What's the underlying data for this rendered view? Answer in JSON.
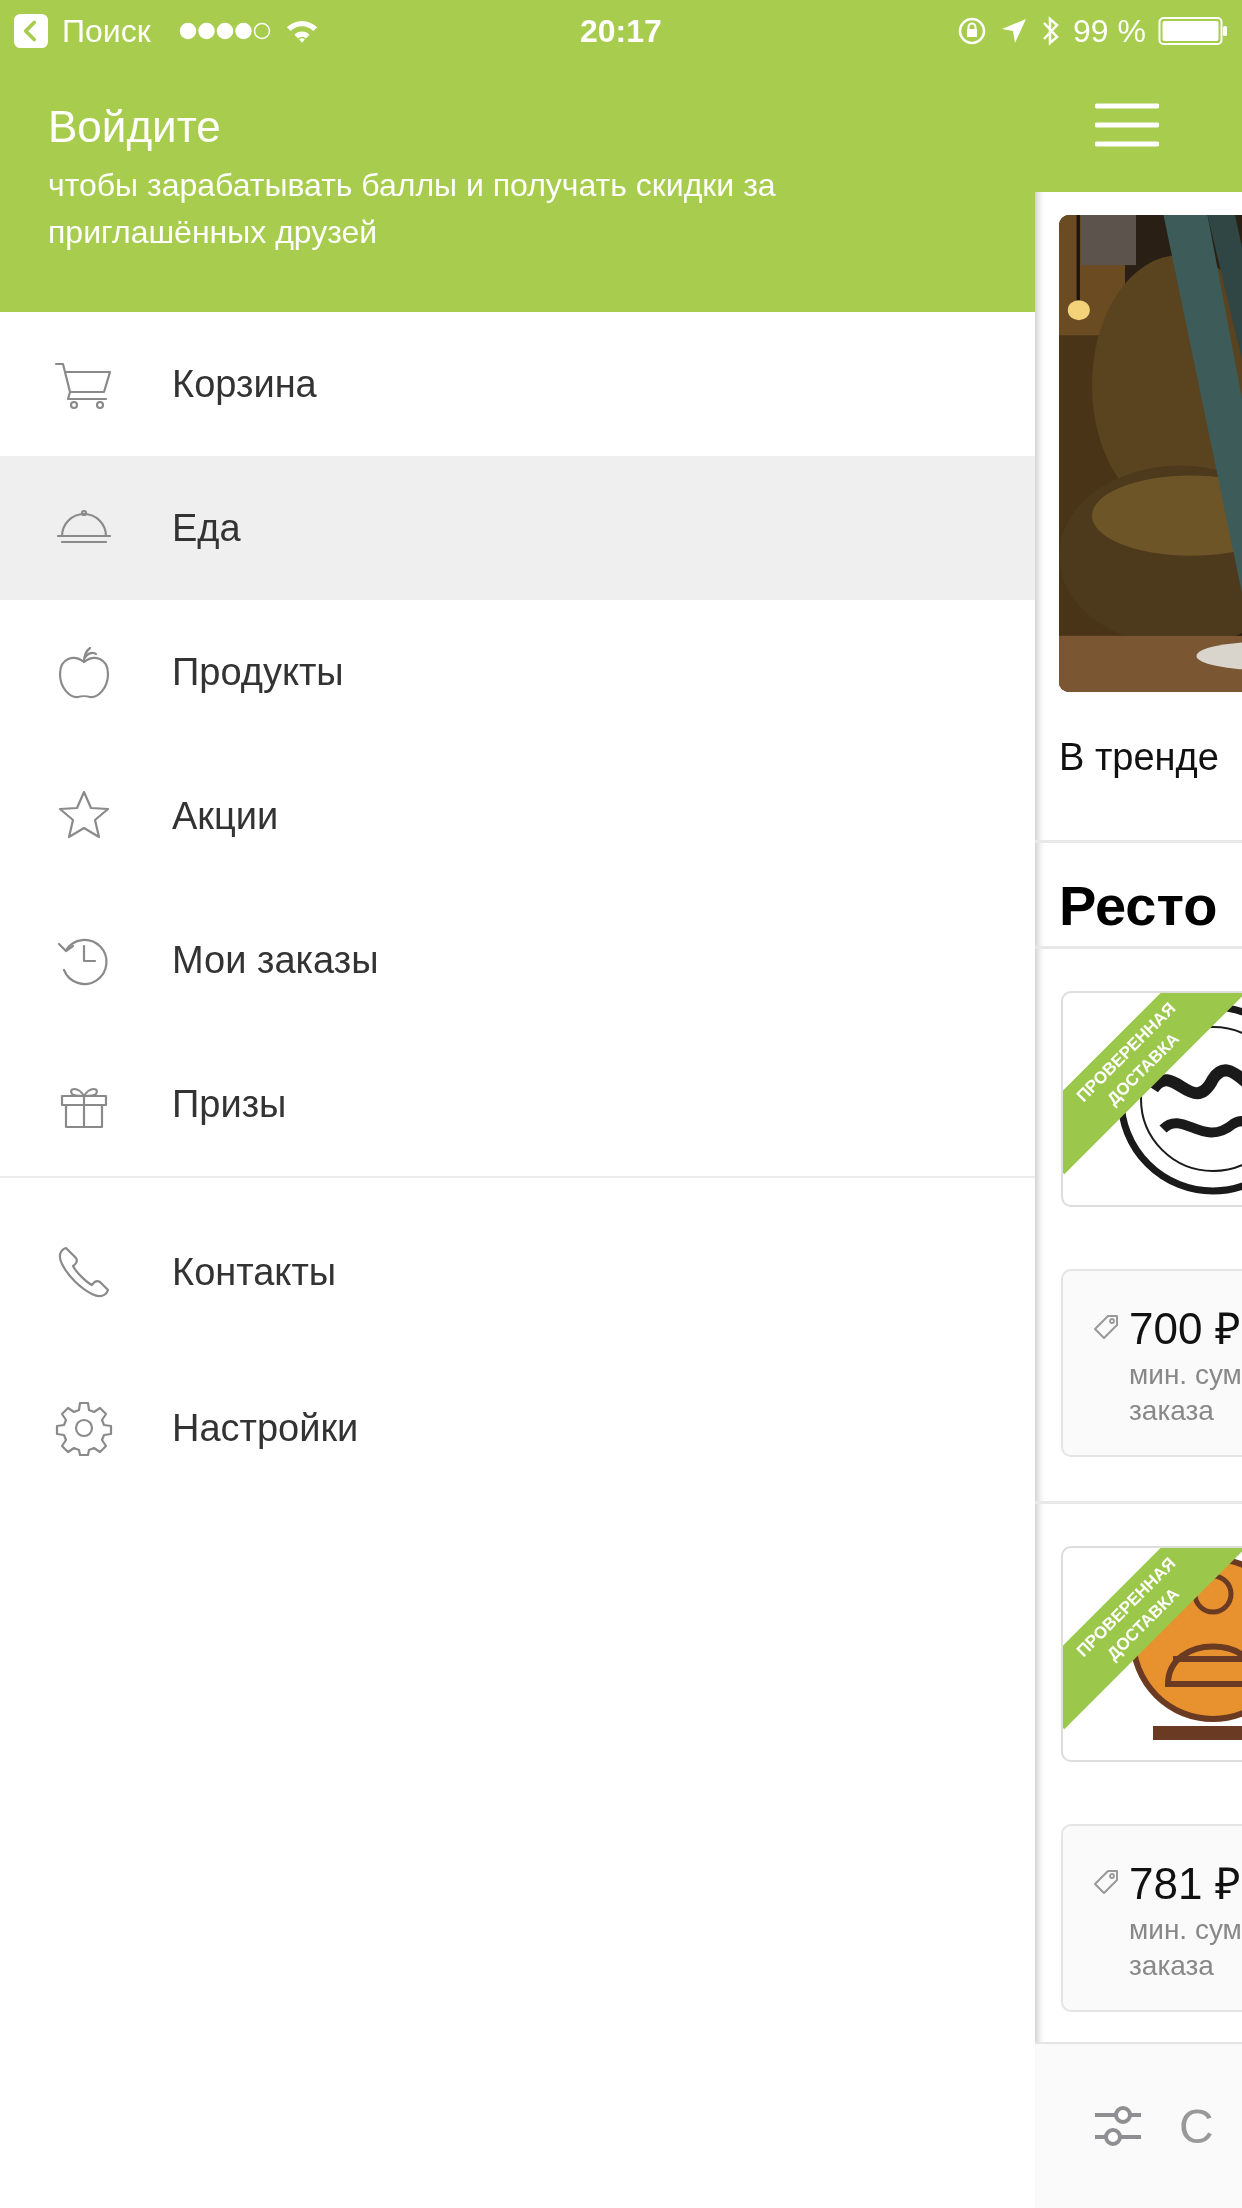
{
  "status_bar": {
    "back_label": "Поиск",
    "time": "20:17",
    "battery": "99 %"
  },
  "drawer": {
    "title": "Войдите",
    "subtitle": "чтобы зарабатывать баллы и получать скидки за приглашённых друзей",
    "sections": [
      {
        "items": [
          {
            "label": "Корзина",
            "selected": false
          },
          {
            "label": "Еда",
            "selected": true
          },
          {
            "label": "Продукты",
            "selected": false
          },
          {
            "label": "Акции",
            "selected": false
          },
          {
            "label": "Мои заказы",
            "selected": false
          },
          {
            "label": "Призы",
            "selected": false
          }
        ]
      },
      {
        "items": [
          {
            "label": "Контакты",
            "selected": false
          },
          {
            "label": "Настройки",
            "selected": false
          }
        ]
      }
    ]
  },
  "main": {
    "trending_label": "В тренде",
    "restaurants_heading": "Ресто",
    "restaurants": [
      {
        "badge": "ПРОВЕРЕННАЯ ДОСТАВКА",
        "min_order": "700 ₽",
        "min_order_label": [
          "мин. сум",
          "заказа"
        ]
      },
      {
        "badge": "ПРОВЕРЕННАЯ ДОСТАВКА",
        "min_order": "781 ₽",
        "min_order_label": [
          "мин. сум",
          "заказа"
        ]
      }
    ],
    "bottom_bar": {
      "label": "С"
    }
  }
}
